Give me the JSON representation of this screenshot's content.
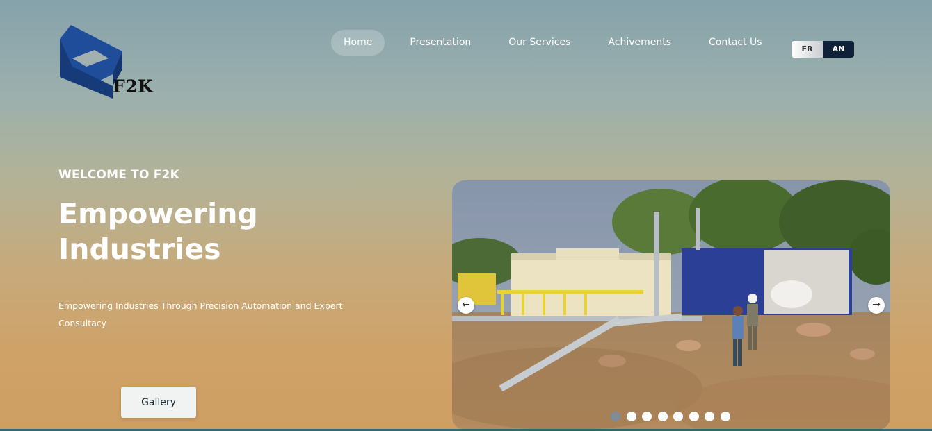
{
  "logo": {
    "text": "F2K",
    "icon": "f2k-logo-icon"
  },
  "nav": {
    "items": [
      {
        "label": "Home",
        "active": true
      },
      {
        "label": "Presentation",
        "active": false
      },
      {
        "label": "Our Services",
        "active": false
      },
      {
        "label": "Achivements",
        "active": false
      },
      {
        "label": "Contact Us",
        "active": false
      }
    ]
  },
  "language": {
    "fr": "FR",
    "an": "AN",
    "selected": "AN"
  },
  "hero": {
    "welcome": "WELCOME TO F2K",
    "headline": "Empowering Industries",
    "description": "Empowering Industries Through Precision Automation and Expert Consultacy",
    "gallery_button": "Gallery"
  },
  "carousel": {
    "prev_icon": "arrow-left-icon",
    "next_icon": "arrow-right-icon",
    "slide_count": 8,
    "active_slide": 1
  },
  "colors": {
    "language_active_bg": "#0e2138",
    "logo_blue": "#1f4d9a",
    "strip": "#2f6a73"
  }
}
